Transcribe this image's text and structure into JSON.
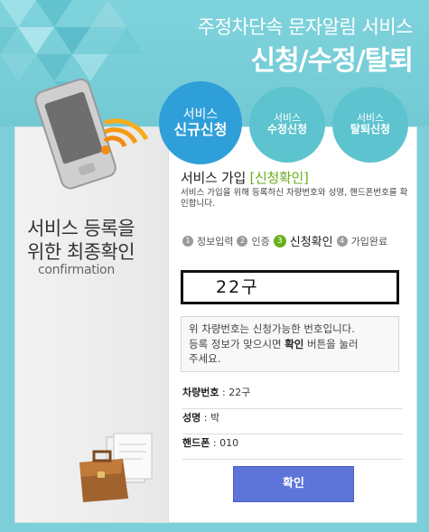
{
  "header": {
    "subtitle": "주정차단속 문자알림 서비스",
    "title": "신청/수정/탈퇴"
  },
  "tabs": [
    {
      "line1": "서비스",
      "line2": "신규신청",
      "active": true
    },
    {
      "line1": "서비스",
      "line2": "수정신청",
      "active": false
    },
    {
      "line1": "서비스",
      "line2": "탈퇴신청",
      "active": false
    }
  ],
  "left": {
    "title_line1": "서비스 등록을",
    "title_line2": "위한 최종확인",
    "subtitle": "confirmation"
  },
  "form": {
    "title_prefix": "서비스 가입",
    "title_accent": "[신청확인]",
    "description": "서비스 가입을 위해 등록하신 차량번호와 성명, 핸드폰번호를 확인합니다.",
    "steps": [
      {
        "num": "1",
        "label": "정보입력"
      },
      {
        "num": "2",
        "label": "인증"
      },
      {
        "num": "3",
        "label": "신청확인"
      },
      {
        "num": "4",
        "label": "가입완료"
      }
    ],
    "plate_value": "22구",
    "notice_line1": "위 차량번호는 신청가능한 번호입니다.",
    "notice_line2a": "등록 정보가 맞으시면 ",
    "notice_bold": "확인",
    "notice_line2b": " 버튼을 눌러",
    "notice_line3": "주세요.",
    "rows": [
      {
        "label": "차량번호",
        "value": "22구"
      },
      {
        "label": "성명",
        "value": "박"
      },
      {
        "label": "핸드폰",
        "value": "010"
      }
    ],
    "confirm_label": "확인"
  },
  "colors": {
    "background": "#7dcfd9",
    "active_tab": "#2f9fd9",
    "inactive_tab": "#5cc3cf",
    "accent_green": "#6aaf1e",
    "button": "#5d74d8"
  }
}
